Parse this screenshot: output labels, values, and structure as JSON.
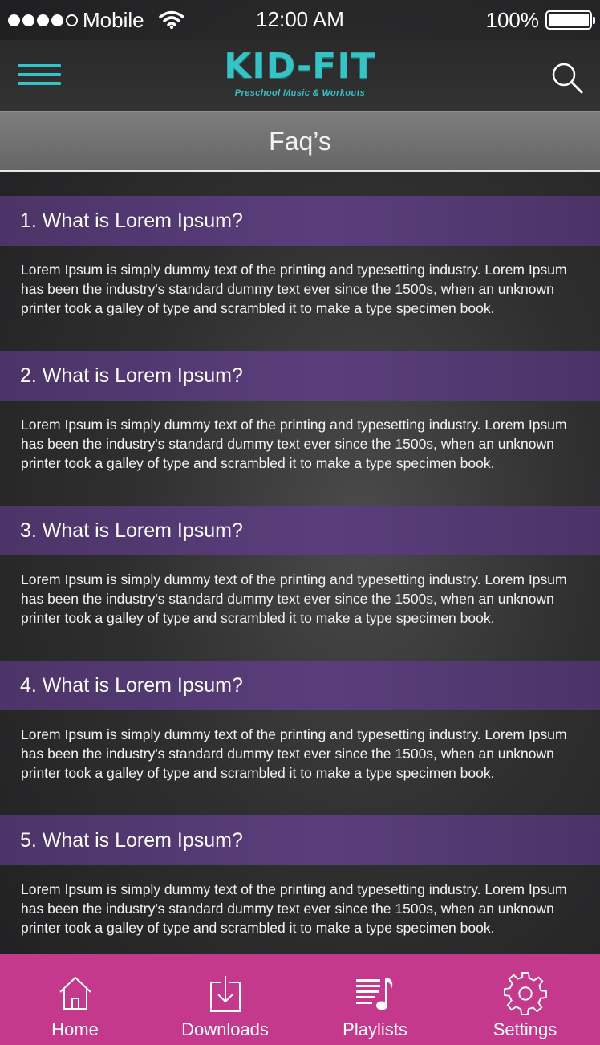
{
  "status": {
    "carrier": "Mobile",
    "time": "12:00 AM",
    "battery": "100%",
    "battery_level": 1.0,
    "signal_bars": 4,
    "signal_max": 5
  },
  "header": {
    "logo_title": "KID-FIT",
    "logo_subtitle": "Preschool Music & Workouts",
    "menu_icon": "hamburger-icon",
    "search_icon": "search-icon",
    "accent_color": "#35c3c6"
  },
  "page": {
    "title": "Faq’s"
  },
  "faqs": [
    {
      "question": "1. What is Lorem Ipsum?",
      "answer": "Lorem Ipsum is simply dummy text of the printing and typesetting industry. Lorem Ipsum has been the industry's standard dummy text ever since the 1500s, when an unknown printer took a galley of type and scrambled it to make a type specimen book."
    },
    {
      "question": "2. What is Lorem Ipsum?",
      "answer": "Lorem Ipsum is simply dummy text of the printing and typesetting industry. Lorem Ipsum has been the industry's standard dummy text ever since the 1500s, when an unknown printer took a galley of type and scrambled it to make a type specimen book."
    },
    {
      "question": "3. What is Lorem Ipsum?",
      "answer": "Lorem Ipsum is simply dummy text of the printing and typesetting industry. Lorem Ipsum has been the industry's standard dummy text ever since the 1500s, when an unknown printer took a galley of type and scrambled it to make a type specimen book."
    },
    {
      "question": "4. What is Lorem Ipsum?",
      "answer": "Lorem Ipsum is simply dummy text of the printing and typesetting industry. Lorem Ipsum has been the industry's standard dummy text ever since the 1500s, when an unknown printer took a galley of type and scrambled it to make a type specimen book."
    },
    {
      "question": "5. What is Lorem Ipsum?",
      "answer": "Lorem Ipsum is simply dummy text of the printing and typesetting industry. Lorem Ipsum has been the industry's standard dummy text ever since the 1500s, when an unknown printer took a galley of type and scrambled it to make a type specimen book."
    }
  ],
  "tabs": [
    {
      "label": "Home",
      "icon": "home-icon"
    },
    {
      "label": "Downloads",
      "icon": "download-icon"
    },
    {
      "label": "Playlists",
      "icon": "playlist-icon"
    },
    {
      "label": "Settings",
      "icon": "gear-icon"
    }
  ],
  "colors": {
    "question_bar": "#55397a",
    "tab_bar": "#c5398d",
    "title_bar": "#717172"
  }
}
